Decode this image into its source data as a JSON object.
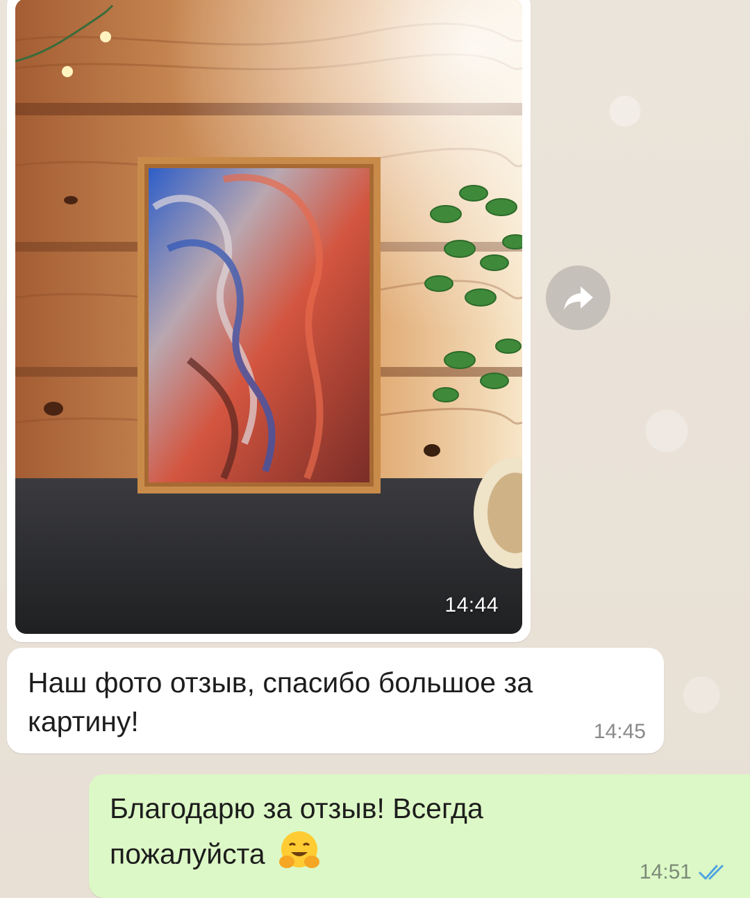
{
  "messages": [
    {
      "type": "image",
      "direction": "incoming",
      "content": "photo-of-painting",
      "time": "14:44"
    },
    {
      "type": "text",
      "direction": "incoming",
      "text": "Наш фото отзыв, спасибо большое за картину!",
      "time": "14:45"
    },
    {
      "type": "text",
      "direction": "outgoing",
      "text": "Благодарю за отзыв! Всегда пожалуйста",
      "emoji": "hugging-face",
      "time": "14:51",
      "status": "read"
    }
  ],
  "icons": {
    "forward": "forward-arrow-icon",
    "read_receipt": "double-check-icon"
  },
  "colors": {
    "wallpaper": "#ece5dc",
    "incoming_bubble": "#ffffff",
    "outgoing_bubble": "#dcf8c6",
    "read_checks": "#4fa3e0",
    "forward_button": "#c5c0ba"
  }
}
